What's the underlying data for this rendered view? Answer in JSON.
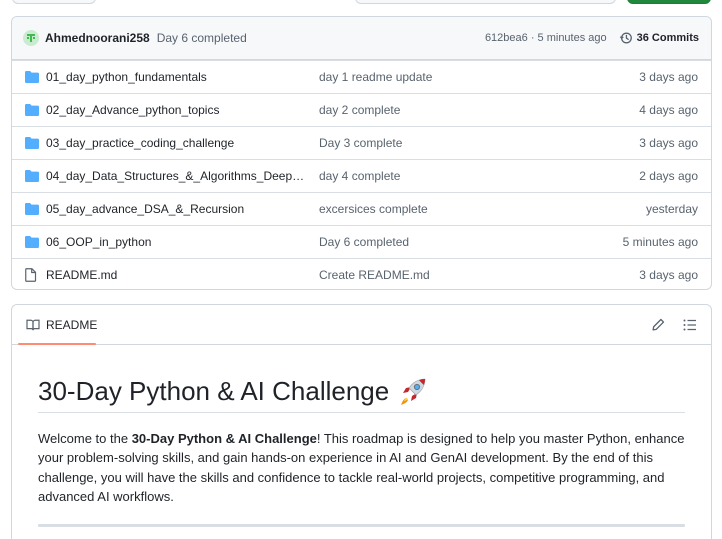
{
  "commit": {
    "author": "Ahmednoorani258",
    "message": "Day 6 completed",
    "hash_time": "612bea6 · 5 minutes ago",
    "commits_label": "36 Commits"
  },
  "files": [
    {
      "name": "01_day_python_fundamentals",
      "message": "day 1 readme update",
      "date": "3 days ago",
      "icon": "folder-icon"
    },
    {
      "name": "02_day_Advance_python_topics",
      "message": "day 2 complete",
      "date": "4 days ago",
      "icon": "folder-icon"
    },
    {
      "name": "03_day_practice_coding_challenge",
      "message": "Day 3 complete",
      "date": "3 days ago",
      "icon": "folder-icon"
    },
    {
      "name": "04_day_Data_Structures_&_Algorithms_Deep_...",
      "message": "day 4 complete",
      "date": "2 days ago",
      "icon": "folder-icon"
    },
    {
      "name": "05_day_advance_DSA_&_Recursion",
      "message": "excersices complete",
      "date": "yesterday",
      "icon": "folder-icon"
    },
    {
      "name": "06_OOP_in_python",
      "message": "Day 6 completed",
      "date": "5 minutes ago",
      "icon": "folder-icon"
    },
    {
      "name": "README.md",
      "message": "Create README.md",
      "date": "3 days ago",
      "icon": "file-icon"
    }
  ],
  "readme": {
    "tab_label": "README",
    "title": "30-Day Python & AI Challenge",
    "intro_pre": "Welcome to the ",
    "intro_bold": "30-Day Python & AI Challenge",
    "intro_post": "! This roadmap is designed to help you master Python, enhance your problem-solving skills, and gain hands-on experience in AI and GenAI development. By the end of this challenge, you will have the skills and confidence to tackle real-world projects, competitive programming, and advanced AI workflows."
  },
  "colors": {
    "folder": "#54aeff",
    "accent_underline": "#fd8c73",
    "muted_text": "#59636e"
  }
}
